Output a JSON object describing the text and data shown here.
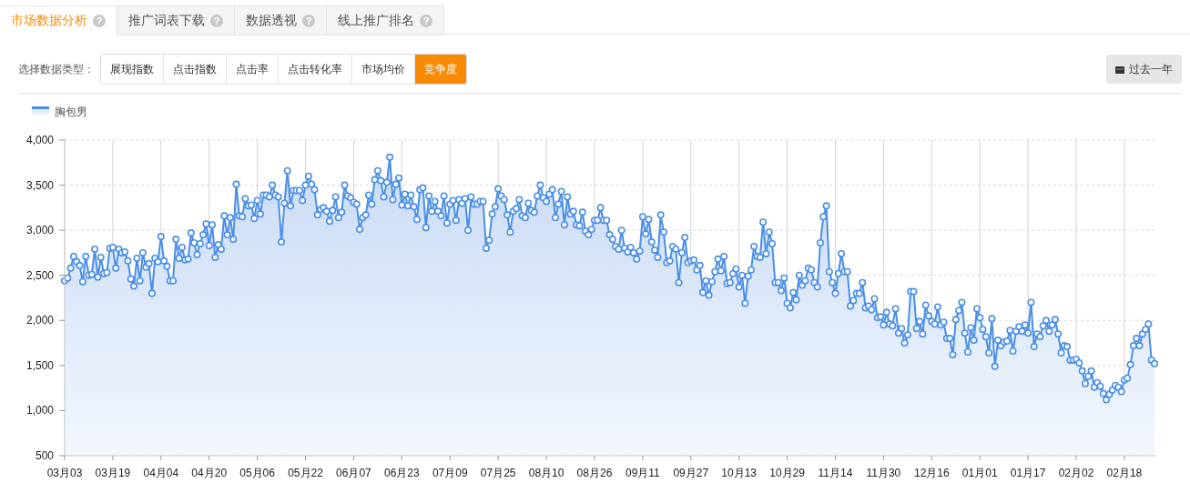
{
  "tabs": [
    {
      "label": "市场数据分析",
      "help": "?",
      "selected": true
    },
    {
      "label": "推广词表下载",
      "help": "?",
      "selected": false
    },
    {
      "label": "数据透视",
      "help": "?",
      "selected": false
    },
    {
      "label": "线上推广排名",
      "help": "?",
      "selected": false
    }
  ],
  "filter": {
    "label": "选择数据类型：",
    "options": [
      {
        "label": "展现指数",
        "selected": false
      },
      {
        "label": "点击指数",
        "selected": false
      },
      {
        "label": "点击率",
        "selected": false
      },
      {
        "label": "点击转化率",
        "selected": false
      },
      {
        "label": "市场均价",
        "selected": false
      },
      {
        "label": "竞争度",
        "selected": true
      }
    ]
  },
  "period_button": {
    "label": "过去一年"
  },
  "chart": {
    "chart_data": {
      "type": "area",
      "grid": true,
      "ylim": [
        500,
        4000
      ],
      "categories": [
        "03月03",
        null,
        null,
        null,
        null,
        null,
        null,
        null,
        null,
        null,
        null,
        null,
        null,
        null,
        null,
        null,
        "03月19",
        null,
        null,
        null,
        null,
        null,
        null,
        null,
        null,
        null,
        null,
        null,
        null,
        null,
        null,
        null,
        "04月04",
        null,
        null,
        null,
        null,
        null,
        null,
        null,
        null,
        null,
        null,
        null,
        null,
        null,
        null,
        null,
        "04月20",
        null,
        null,
        null,
        null,
        null,
        null,
        null,
        null,
        null,
        null,
        null,
        null,
        null,
        null,
        null,
        "05月06",
        null,
        null,
        null,
        null,
        null,
        null,
        null,
        null,
        null,
        null,
        null,
        null,
        null,
        null,
        null,
        "05月22",
        null,
        null,
        null,
        null,
        null,
        null,
        null,
        null,
        null,
        null,
        null,
        null,
        null,
        null,
        null,
        "06月07",
        null,
        null,
        null,
        null,
        null,
        null,
        null,
        null,
        null,
        null,
        null,
        null,
        null,
        null,
        null,
        "06月23",
        null,
        null,
        null,
        null,
        null,
        null,
        null,
        null,
        null,
        null,
        null,
        null,
        null,
        null,
        null,
        "07月09",
        null,
        null,
        null,
        null,
        null,
        null,
        null,
        null,
        null,
        null,
        null,
        null,
        null,
        null,
        null,
        "07月25",
        null,
        null,
        null,
        null,
        null,
        null,
        null,
        null,
        null,
        null,
        null,
        null,
        null,
        null,
        null,
        "08月10",
        null,
        null,
        null,
        null,
        null,
        null,
        null,
        null,
        null,
        null,
        null,
        null,
        null,
        null,
        null,
        "08月26",
        null,
        null,
        null,
        null,
        null,
        null,
        null,
        null,
        null,
        null,
        null,
        null,
        null,
        null,
        null,
        "09月11",
        null,
        null,
        null,
        null,
        null,
        null,
        null,
        null,
        null,
        null,
        null,
        null,
        null,
        null,
        null,
        "09月27",
        null,
        null,
        null,
        null,
        null,
        null,
        null,
        null,
        null,
        null,
        null,
        null,
        null,
        null,
        null,
        "10月13",
        null,
        null,
        null,
        null,
        null,
        null,
        null,
        null,
        null,
        null,
        null,
        null,
        null,
        null,
        null,
        "10月29",
        null,
        null,
        null,
        null,
        null,
        null,
        null,
        null,
        null,
        null,
        null,
        null,
        null,
        null,
        null,
        "11月14",
        null,
        null,
        null,
        null,
        null,
        null,
        null,
        null,
        null,
        null,
        null,
        null,
        null,
        null,
        null,
        "11月30",
        null,
        null,
        null,
        null,
        null,
        null,
        null,
        null,
        null,
        null,
        null,
        null,
        null,
        null,
        null,
        "12月16",
        null,
        null,
        null,
        null,
        null,
        null,
        null,
        null,
        null,
        null,
        null,
        null,
        null,
        null,
        null,
        "01月01",
        null,
        null,
        null,
        null,
        null,
        null,
        null,
        null,
        null,
        null,
        null,
        null,
        null,
        null,
        null,
        "01月17",
        null,
        null,
        null,
        null,
        null,
        null,
        null,
        null,
        null,
        null,
        null,
        null,
        null,
        null,
        null,
        "02月02",
        null,
        null,
        null,
        null,
        null,
        null,
        null,
        null,
        null,
        null,
        null,
        null,
        null,
        null,
        null,
        "02月18",
        null,
        null,
        null,
        null,
        null,
        null,
        null,
        null,
        null,
        null
      ],
      "yticks": [
        {
          "value": 500,
          "label": "500"
        },
        {
          "value": 1000,
          "label": "1,000"
        },
        {
          "value": 1500,
          "label": "1,500"
        },
        {
          "value": 2000,
          "label": "2,000"
        },
        {
          "value": 2500,
          "label": "2,500"
        },
        {
          "value": 3000,
          "label": "3,000"
        },
        {
          "value": 3500,
          "label": "3,500"
        },
        {
          "value": 4000,
          "label": "4,000"
        }
      ],
      "series": [
        {
          "name": "胸包男",
          "color": "#4a8fe7",
          "values": [
            2440,
            2470,
            2580,
            2710,
            2650,
            2610,
            2430,
            2710,
            2500,
            2510,
            2790,
            2480,
            2700,
            2520,
            2530,
            2800,
            2810,
            2580,
            2790,
            2750,
            2760,
            2660,
            2460,
            2380,
            2690,
            2440,
            2750,
            2590,
            2630,
            2300,
            2690,
            2650,
            2930,
            2660,
            2600,
            2440,
            2440,
            2900,
            2690,
            2810,
            2670,
            2680,
            2970,
            2860,
            2730,
            2850,
            2950,
            3070,
            2830,
            3060,
            2700,
            2840,
            2790,
            3160,
            2950,
            3140,
            2900,
            3510,
            3160,
            3150,
            3350,
            3270,
            3280,
            3130,
            3330,
            3180,
            3390,
            3390,
            3370,
            3500,
            3390,
            3370,
            2870,
            3300,
            3660,
            3270,
            3440,
            3440,
            3440,
            3330,
            3500,
            3600,
            3510,
            3450,
            3170,
            3230,
            3250,
            3210,
            3100,
            3220,
            3370,
            3140,
            3200,
            3500,
            3380,
            3360,
            3310,
            3290,
            3010,
            3140,
            3170,
            3390,
            3290,
            3560,
            3660,
            3550,
            3370,
            3530,
            3810,
            3340,
            3510,
            3580,
            3280,
            3400,
            3270,
            3390,
            3260,
            3120,
            3450,
            3470,
            3030,
            3380,
            3210,
            3320,
            3210,
            3160,
            3380,
            3080,
            3290,
            3330,
            3110,
            3340,
            3300,
            3350,
            3000,
            3370,
            3290,
            3290,
            3320,
            3320,
            2800,
            2890,
            3180,
            3260,
            3460,
            3380,
            3340,
            3170,
            2980,
            3210,
            3240,
            3340,
            3160,
            3140,
            3300,
            3220,
            3200,
            3380,
            3500,
            3360,
            3320,
            3400,
            3450,
            3140,
            3290,
            3430,
            3060,
            3370,
            3180,
            3210,
            3060,
            3050,
            3200,
            2990,
            2950,
            3010,
            3110,
            3110,
            3250,
            3110,
            3110,
            2950,
            2900,
            2820,
            2790,
            3000,
            2800,
            2760,
            2810,
            2750,
            2680,
            2770,
            3150,
            2960,
            3120,
            2870,
            2780,
            2700,
            3170,
            2980,
            2640,
            2660,
            2820,
            2790,
            2420,
            2750,
            2920,
            2640,
            2660,
            2670,
            2560,
            2610,
            2310,
            2440,
            2280,
            2430,
            2540,
            2680,
            2550,
            2710,
            2410,
            2420,
            2520,
            2570,
            2370,
            2500,
            2190,
            2490,
            2560,
            2820,
            2710,
            2700,
            3090,
            2740,
            2980,
            2850,
            2420,
            2420,
            2330,
            2470,
            2190,
            2140,
            2310,
            2230,
            2500,
            2390,
            2440,
            2580,
            2560,
            2420,
            2370,
            2860,
            3150,
            3270,
            2540,
            2420,
            2300,
            2520,
            2740,
            2540,
            2540,
            2160,
            2220,
            2300,
            2300,
            2420,
            2140,
            2160,
            2120,
            2240,
            2030,
            2040,
            1950,
            2090,
            1960,
            1940,
            2130,
            1860,
            1910,
            1750,
            1840,
            2320,
            2320,
            1910,
            1990,
            1850,
            2170,
            2050,
            1990,
            1960,
            2150,
            1950,
            1980,
            1800,
            1800,
            1620,
            2010,
            2110,
            2200,
            1860,
            1650,
            1920,
            1780,
            2130,
            2030,
            1900,
            1820,
            1640,
            2020,
            1490,
            1780,
            1720,
            1760,
            1770,
            1890,
            1660,
            1880,
            1930,
            1880,
            1950,
            1860,
            2200,
            1710,
            1850,
            1820,
            1940,
            2000,
            1880,
            1950,
            2010,
            1850,
            1640,
            1720,
            1710,
            1560,
            1560,
            1570,
            1530,
            1440,
            1300,
            1380,
            1440,
            1260,
            1310,
            1270,
            1190,
            1120,
            1180,
            1230,
            1280,
            1260,
            1210,
            1340,
            1360,
            1510,
            1720,
            1800,
            1720,
            1850,
            1900,
            1960,
            1560,
            1520
          ]
        }
      ]
    }
  }
}
